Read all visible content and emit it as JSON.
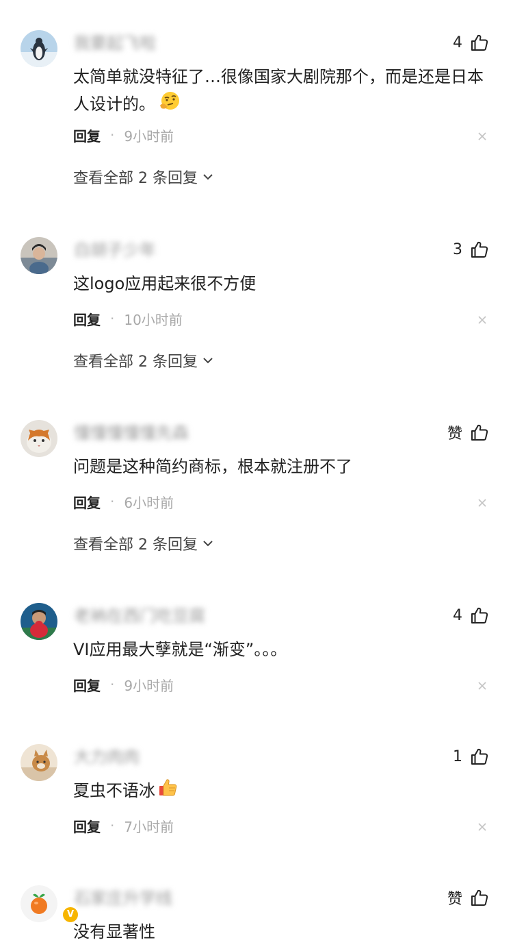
{
  "comments": [
    {
      "username": "我要起飞啦",
      "likes": "4",
      "text": "太简单就没特征了…很像国家大剧院那个，而是还是日本人设计的。",
      "emoji": "thinking-face",
      "reply_label": "回复",
      "separator": "·",
      "time": "9小时前",
      "view_replies": "查看全部 2 条回复"
    },
    {
      "username": "白胡子少年",
      "likes": "3",
      "text": "这logo应用起来很不方便",
      "reply_label": "回复",
      "separator": "·",
      "time": "10小时前",
      "view_replies": "查看全部 2 条回复"
    },
    {
      "username": "懂懂懂懂懂先森",
      "likes": "赞",
      "text": "问题是这种简约商标，根本就注册不了",
      "reply_label": "回复",
      "separator": "·",
      "time": "6小时前",
      "view_replies": "查看全部 2 条回复"
    },
    {
      "username": "老衲在西门吃豆腐",
      "likes": "4",
      "text": "VI应用最大孽就是“渐变”。。。",
      "reply_label": "回复",
      "separator": "·",
      "time": "9小时前"
    },
    {
      "username": "大力肉肉",
      "likes": "1",
      "text": "夏虫不语冰",
      "emoji": "thumbs-up",
      "reply_label": "回复",
      "separator": "·",
      "time": "7小时前"
    },
    {
      "username": "石家庄升学线",
      "likes": "赞",
      "text": "没有显著性",
      "verified_badge": "V"
    }
  ]
}
